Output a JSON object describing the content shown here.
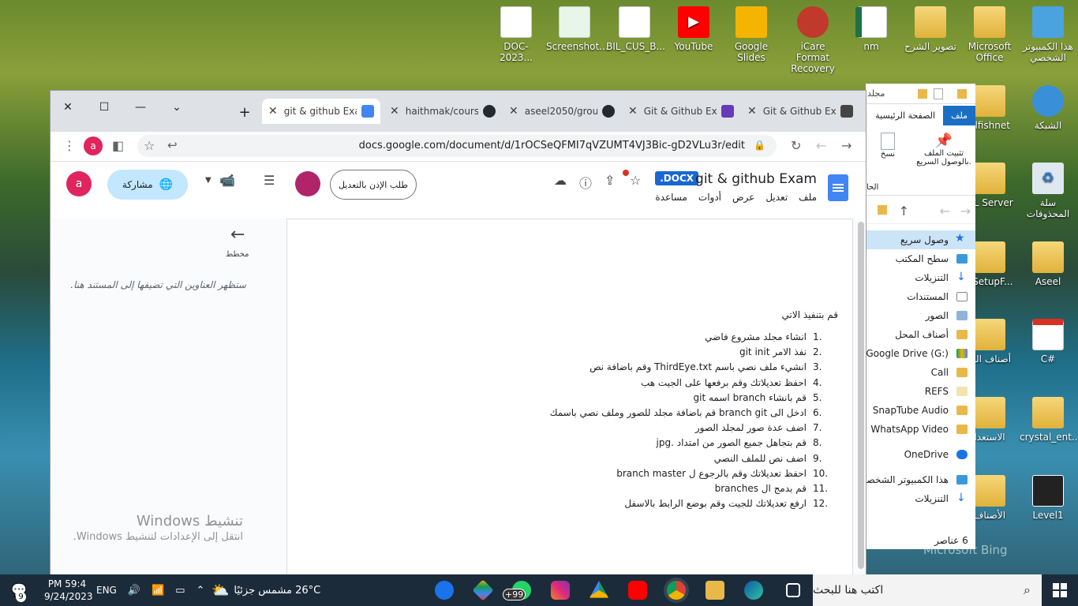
{
  "desktop": {
    "icons": [
      {
        "label": "DOC-2023..."
      },
      {
        "label": "Screenshot..."
      },
      {
        "label": "BIL_CUS_B..."
      },
      {
        "label": "YouTube"
      },
      {
        "label": "Google Slides"
      },
      {
        "label": "iCare Format Recovery"
      },
      {
        "label": "nm"
      },
      {
        "label": "تصوير الشرح"
      },
      {
        "label": "Microsoft Office"
      },
      {
        "label": "هذا الكمبيوتر الشخصي"
      },
      {
        "label": "elfishnet"
      },
      {
        "label": "الشبكة"
      },
      {
        "label": "QL Server"
      },
      {
        "label": "سلة المحذوفات"
      },
      {
        "label": "nSetupF..."
      },
      {
        "label": "Aseel"
      },
      {
        "label": "أصناف الك"
      },
      {
        "label": "C#"
      },
      {
        "label": "الاستعدا"
      },
      {
        "label": "crystal_ent..."
      },
      {
        "label": "الأصناف"
      },
      {
        "label": "Level1"
      }
    ],
    "bing_watermark": "Microsoft Bing"
  },
  "explorer": {
    "title_fragment": "مجلد",
    "tabs": {
      "file": "ملف",
      "home": "الصفحة الرئيسية"
    },
    "ribbon": {
      "pin": "تثبيت الملف بالوصول السريع.",
      "copy": "نسخ",
      "clipboard": "الحا"
    },
    "nav": [
      {
        "label": "وصول سريع"
      },
      {
        "label": "سطح المكتب"
      },
      {
        "label": "التنزيلات"
      },
      {
        "label": "المستندات"
      },
      {
        "label": "الصور"
      },
      {
        "label": "أصناف المحل"
      },
      {
        "label": "Google Drive (G:)"
      },
      {
        "label": "Call"
      },
      {
        "label": "REFS"
      },
      {
        "label": "SnapTube Audio"
      },
      {
        "label": "WhatsApp Video"
      },
      {
        "label": "OneDrive"
      },
      {
        "label": "هذا الكمبيوتر الشخصي"
      },
      {
        "label": "التنزيلات"
      }
    ],
    "status": "6 عناصر"
  },
  "browser": {
    "tabs": [
      {
        "title": "git & github Exa",
        "active": true
      },
      {
        "title": "haithmak/cours"
      },
      {
        "title": "aseel2050/grou"
      },
      {
        "title": "Git & Github Ex"
      },
      {
        "title": "Git & Github Ex"
      }
    ],
    "url": "docs.google.com/document/d/1rOCSeQFMI7qVZUMT4VJ3Bic-gD2VLu3r/edit",
    "profile_initial": "a"
  },
  "docs": {
    "title": "git & github Exam",
    "badge": ".DOCX",
    "menu": [
      "ملف",
      "تعديل",
      "عرض",
      "أدوات",
      "مساعدة"
    ],
    "request_edit": "طلب الإذن بالتعديل",
    "share": "مشاركة",
    "avatar_initial": "a",
    "outline": {
      "title": "مخطط",
      "placeholder": "ستظهر العناوين التي تضيفها إلى المستند هنا."
    },
    "intro": "قم بتنفيذ الاتي",
    "items": [
      {
        "n": "1.",
        "text": "انشاء مجلد مشروع فاضي"
      },
      {
        "n": "2.",
        "text": "نفذ الامر git init"
      },
      {
        "n": "3.",
        "text": "انشيء ملف نصي باسم ThirdEye.txt  وقم باضافة نص"
      },
      {
        "n": "4.",
        "text": "احفظ تعديلاتك وقم برفعها على الجيت هب"
      },
      {
        "n": "5.",
        "text": "قم بانشاء branch اسمه git"
      },
      {
        "n": "6.",
        "text": "ادخل الى branch git قم باضافة مجلد للصور وملف نصي باسمك"
      },
      {
        "n": "7.",
        "text": "اضف عدة صور لمجلد الصور"
      },
      {
        "n": "8.",
        "text": "قم بتجاهل جميع الصور من امتداد .jpg"
      },
      {
        "n": "9.",
        "text": "اضف نص للملف النصي"
      },
      {
        "n": "10.",
        "text": "احفظ تعديلاتك وقم بالرجوع ل branch master"
      },
      {
        "n": "11.",
        "text": "قم بدمج ال branches"
      },
      {
        "n": "12.",
        "text": "ارفع تعديلاتك للجيت وقم بوضع الرابط بالاسفل"
      }
    ]
  },
  "activation": {
    "title": "تنشيط Windows",
    "subtitle": "انتقل إلى الإعدادات لتنشيط Windows."
  },
  "taskbar": {
    "search_placeholder": "اكتب هنا للبحث",
    "weather": "26°C  مشمس جزئيًا",
    "language": "ENG",
    "time": "PM 59:4",
    "date": "9/24/2023",
    "notifications": "9",
    "whatsapp_badge": "+99"
  }
}
